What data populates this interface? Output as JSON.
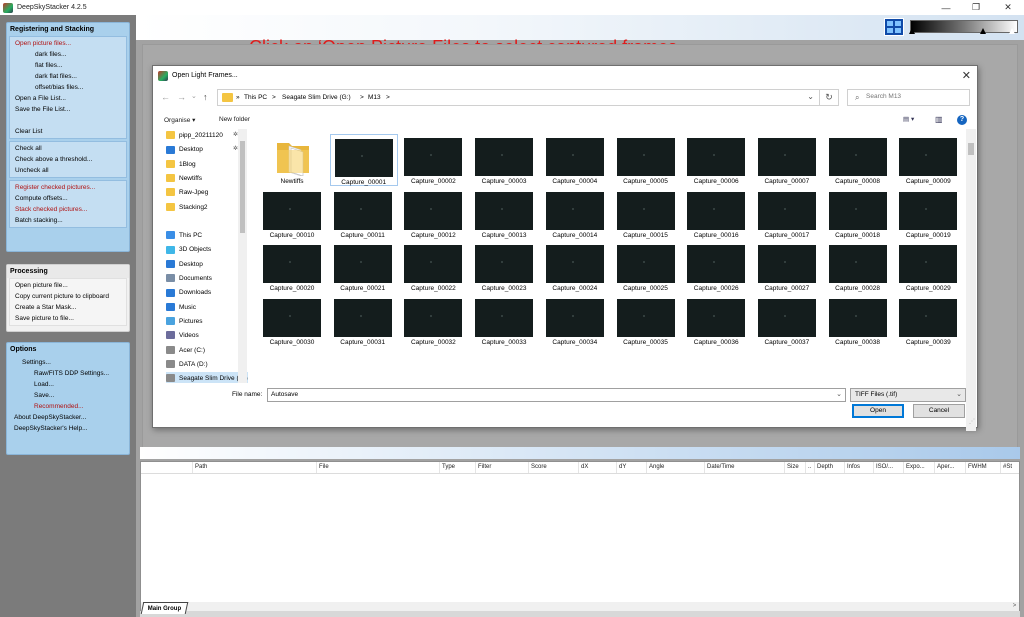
{
  "window": {
    "title": "DeepSkyStacker 4.2.5",
    "minimize": "—",
    "maximize": "❐",
    "close": "✕"
  },
  "caption": "Click on ‘Open Picture Files to select captured frames",
  "left_panel": {
    "groups": [
      {
        "title": "Registering and Stacking",
        "sections": [
          [
            {
              "label": "Open picture files...",
              "indent": 0,
              "red": true
            },
            {
              "label": "dark files...",
              "indent": 2
            },
            {
              "label": "flat files...",
              "indent": 2
            },
            {
              "label": "dark flat files...",
              "indent": 2
            },
            {
              "label": "offset/bias files...",
              "indent": 2
            },
            {
              "label": "Open a File List...",
              "indent": 0
            },
            {
              "label": "Save the File List...",
              "indent": 0
            },
            {
              "label": "",
              "indent": 0
            },
            {
              "label": "Clear List",
              "indent": 0
            }
          ],
          [
            {
              "label": "Check all",
              "indent": 0
            },
            {
              "label": "Check above a threshold...",
              "indent": 0
            },
            {
              "label": "Uncheck all",
              "indent": 0
            }
          ],
          [
            {
              "label": "Register checked pictures...",
              "indent": 0,
              "red": true
            },
            {
              "label": "Compute offsets...",
              "indent": 0
            },
            {
              "label": "Stack checked pictures...",
              "indent": 0,
              "red": true
            },
            {
              "label": "Batch stacking...",
              "indent": 0
            }
          ]
        ]
      },
      {
        "title": "Processing",
        "sections": [
          [
            {
              "label": "Open picture file...",
              "indent": 0
            },
            {
              "label": "Copy current picture to clipboard",
              "indent": 0
            },
            {
              "label": "Create a Star Mask...",
              "indent": 0
            },
            {
              "label": "Save picture to file...",
              "indent": 0
            }
          ]
        ]
      },
      {
        "title": "Options",
        "sections": [
          [
            {
              "label": "Settings...",
              "indent": 1
            },
            {
              "label": "Raw/FITS DDP Settings...",
              "indent": 2
            },
            {
              "label": "Load...",
              "indent": 2
            },
            {
              "label": "Save...",
              "indent": 2
            },
            {
              "label": "Recommended...",
              "indent": 2,
              "red": true
            },
            {
              "label": "About DeepSkyStacker...",
              "indent": 0
            },
            {
              "label": "DeepSkyStacker's Help...",
              "indent": 0
            }
          ]
        ]
      }
    ]
  },
  "dialog": {
    "title": "Open Light Frames...",
    "close": "✕",
    "nav": {
      "back": "←",
      "forward": "→",
      "recent": "⌄",
      "up": "↑"
    },
    "breadcrumb": [
      "»",
      "This PC",
      ">",
      "Seagate Slim Drive (G:)",
      ">",
      "M13",
      ">"
    ],
    "address_dropdown": "⌄",
    "refresh": "↻",
    "search_placeholder": "Search M13",
    "search_icon": "⌕",
    "organise": "Organise ▾",
    "new_folder": "New folder",
    "view_icon": "▤ ▾",
    "pane_icon": "▥",
    "help": "?",
    "nav_pane": [
      {
        "label": "pipp_20211120",
        "icon": "folder",
        "pin": true
      },
      {
        "label": "Desktop",
        "icon": "desktop",
        "pin": true
      },
      {
        "label": "1Blog",
        "icon": "folder"
      },
      {
        "label": "Newtiffs",
        "icon": "folder"
      },
      {
        "label": "Raw-Jpeg",
        "icon": "folder"
      },
      {
        "label": "Stacking2",
        "icon": "folder"
      },
      {
        "label": "",
        "icon": "none"
      },
      {
        "label": "This PC",
        "icon": "pc"
      },
      {
        "label": "3D Objects",
        "icon": "3d"
      },
      {
        "label": "Desktop",
        "icon": "desktop"
      },
      {
        "label": "Documents",
        "icon": "docs"
      },
      {
        "label": "Downloads",
        "icon": "downloads"
      },
      {
        "label": "Music",
        "icon": "music"
      },
      {
        "label": "Pictures",
        "icon": "pictures"
      },
      {
        "label": "Videos",
        "icon": "videos"
      },
      {
        "label": "Acer (C:)",
        "icon": "drive"
      },
      {
        "label": "DATA (D:)",
        "icon": "drive"
      },
      {
        "label": "Seagate Slim Drive (G:)",
        "icon": "drive",
        "selected": true
      }
    ],
    "items": [
      "Newtiffs",
      "Capture_00001",
      "Capture_00002",
      "Capture_00003",
      "Capture_00004",
      "Capture_00005",
      "Capture_00006",
      "Capture_00007",
      "Capture_00008",
      "Capture_00009",
      "Capture_00010",
      "Capture_00011",
      "Capture_00012",
      "Capture_00013",
      "Capture_00014",
      "Capture_00015",
      "Capture_00016",
      "Capture_00017",
      "Capture_00018",
      "Capture_00019",
      "Capture_00020",
      "Capture_00021",
      "Capture_00022",
      "Capture_00023",
      "Capture_00024",
      "Capture_00025",
      "Capture_00026",
      "Capture_00027",
      "Capture_00028",
      "Capture_00029",
      "Capture_00030",
      "Capture_00031",
      "Capture_00032",
      "Capture_00033",
      "Capture_00034",
      "Capture_00035",
      "Capture_00036",
      "Capture_00037",
      "Capture_00038",
      "Capture_00039"
    ],
    "selected_item": "Capture_00001",
    "file_name_label": "File name:",
    "file_name_value": "Autosave",
    "file_type": "TIFF Files (.tif)",
    "dropdown_glyph": "⌄",
    "open": "Open",
    "cancel": "Cancel",
    "grip": "⋰"
  },
  "file_list": {
    "columns": [
      "Path",
      "File",
      "Type",
      "Filter",
      "Score",
      "dX",
      "dY",
      "Angle",
      "Date/Time",
      "Size",
      "..",
      "Depth",
      "Infos",
      "ISO/...",
      "Expo...",
      "Aper...",
      "FWHM",
      "#St"
    ],
    "scroll_left": "<",
    "scroll_right": ">",
    "tab": "Main Group"
  },
  "colors": {
    "accent_red": "#e01b1b",
    "panel_blue": "#a9d0ec",
    "dialog_select": "#cce4f7",
    "primary_button_border": "#0078d7"
  }
}
